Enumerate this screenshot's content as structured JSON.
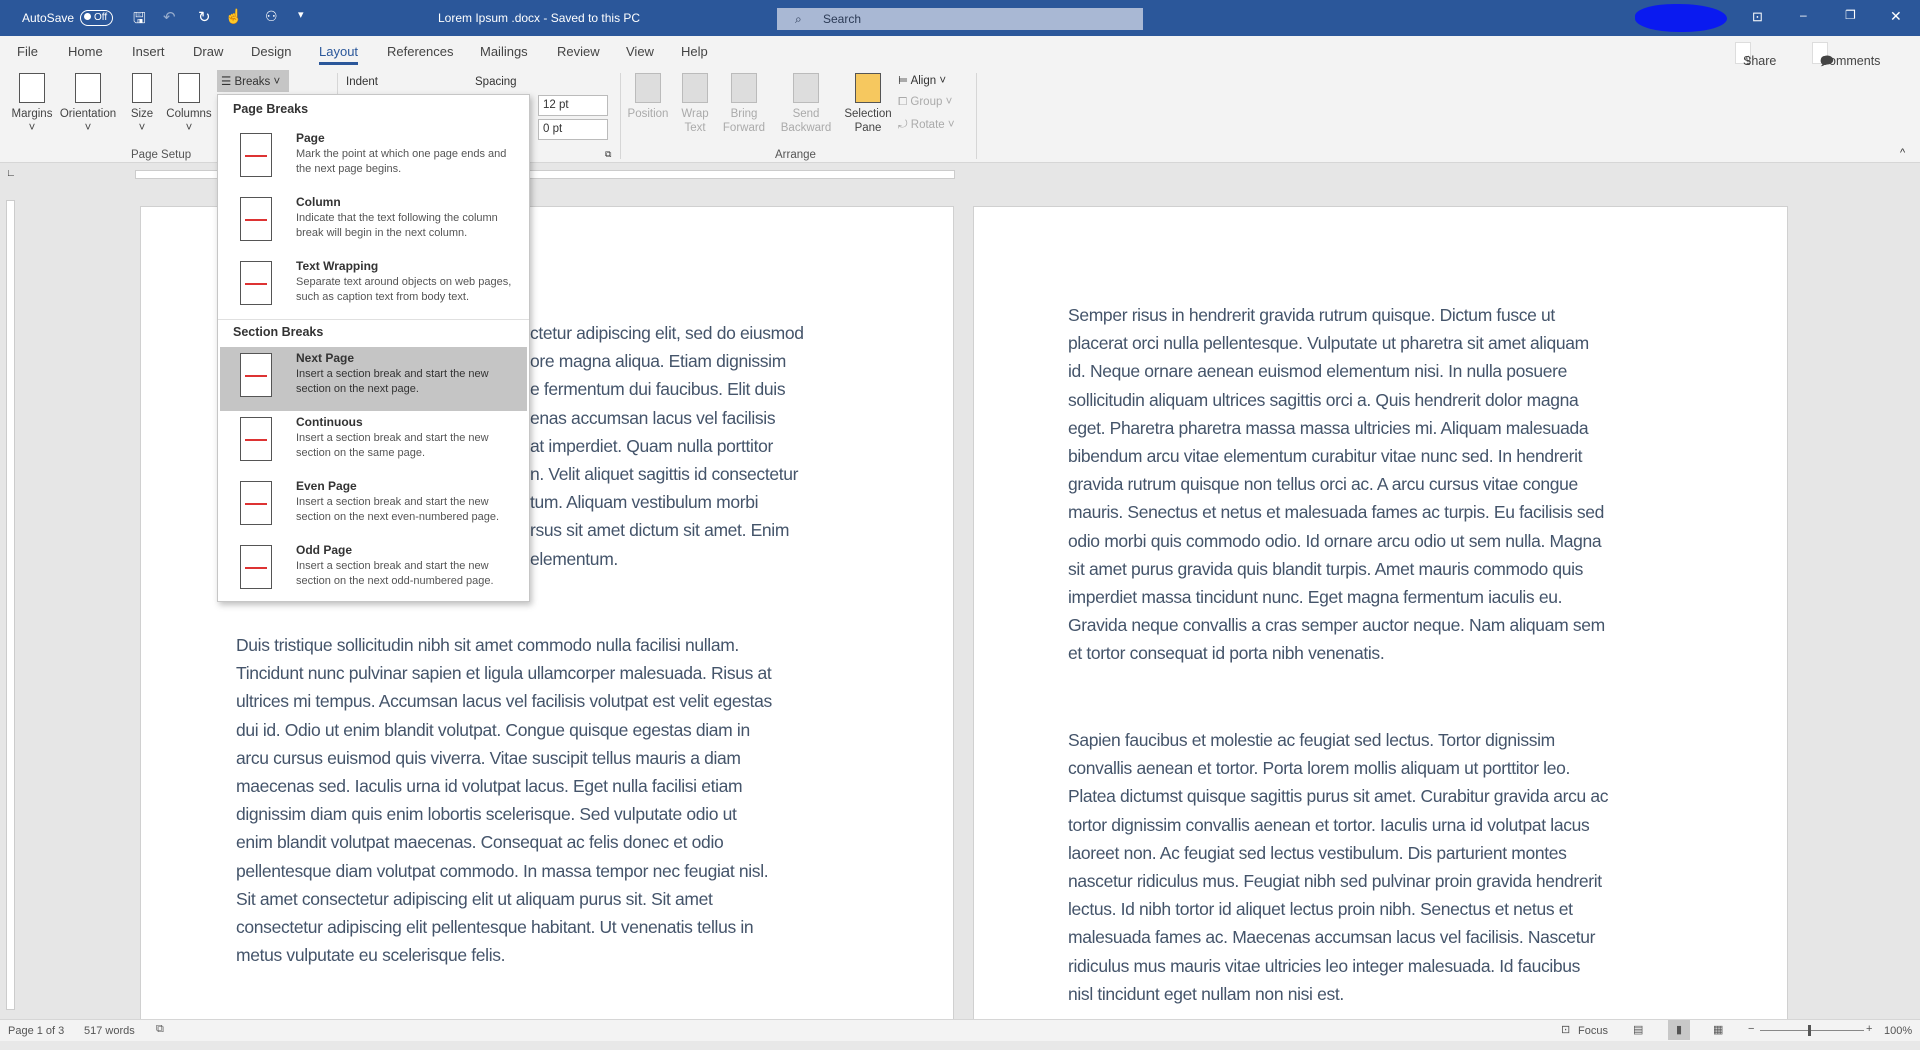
{
  "titlebar": {
    "autosave_label": "AutoSave",
    "autosave_state": "Off",
    "doc_title": "Lorem Ipsum .docx  -  Saved to this PC",
    "search_placeholder": "Search",
    "brand_color": "#2b579a"
  },
  "tabs": [
    "File",
    "Home",
    "Insert",
    "Draw",
    "Design",
    "Layout",
    "References",
    "Mailings",
    "Review",
    "View",
    "Help"
  ],
  "active_tab": "Layout",
  "share_label": "Share",
  "comments_label": "Comments",
  "ribbon": {
    "page_setup": {
      "items": [
        "Margins",
        "Orientation",
        "Size",
        "Columns"
      ],
      "breaks": "Breaks",
      "group": "Page Setup"
    },
    "paragraph": {
      "indent": "Indent",
      "spacing": "Spacing",
      "spacing_before": "12 pt",
      "spacing_after": "0 pt"
    },
    "arrange": {
      "items": [
        "Position",
        "Wrap Text",
        "Bring Forward",
        "Send Backward",
        "Selection Pane"
      ],
      "align": "Align",
      "group_btn": "Group",
      "rotate": "Rotate",
      "group": "Arrange"
    }
  },
  "breaks_menu": {
    "page_breaks_header": "Page Breaks",
    "section_breaks_header": "Section Breaks",
    "page_items": [
      {
        "title": "Page",
        "desc": "Mark the point at which one page ends and the next page begins."
      },
      {
        "title": "Column",
        "desc": "Indicate that the text following the column break will begin in the next column."
      },
      {
        "title": "Text Wrapping",
        "desc": "Separate text around objects on web pages, such as caption text from body text."
      }
    ],
    "section_items": [
      {
        "title": "Next Page",
        "desc": "Insert a section break and start the new section on the next page."
      },
      {
        "title": "Continuous",
        "desc": "Insert a section break and start the new section on the same page."
      },
      {
        "title": "Even Page",
        "desc": "Insert a section break and start the new section on the next even-numbered page."
      },
      {
        "title": "Odd Page",
        "desc": "Insert a section break and start the new section on the next odd-numbered page."
      }
    ],
    "highlighted": "Next Page"
  },
  "page1": {
    "para1_visible_fragments": [
      "ctetur adipiscing elit, sed do eiusmod",
      "ore magna aliqua. Etiam dignissim",
      "e fermentum dui faucibus. Elit duis",
      "enas accumsan lacus vel facilisis",
      "at imperdiet. Quam nulla porttitor",
      "n. Velit aliquet sagittis id consectetur",
      "tum. Aliquam vestibulum morbi",
      "rsus sit amet dictum sit amet. Enim",
      "elementum."
    ],
    "para2": [
      "Duis tristique sollicitudin nibh sit amet commodo nulla facilisi nullam.",
      "Tincidunt nunc pulvinar sapien et ligula ullamcorper malesuada. Risus at",
      "ultrices mi tempus. Accumsan lacus vel facilisis volutpat est velit egestas",
      "dui id. Odio ut enim blandit volutpat. Congue quisque egestas diam in",
      "arcu cursus euismod quis viverra. Vitae suscipit tellus mauris a diam",
      "maecenas sed. Iaculis urna id volutpat lacus. Eget nulla facilisi etiam",
      "dignissim diam quis enim lobortis scelerisque. Sed vulputate odio ut",
      "enim blandit volutpat maecenas. Consequat ac felis donec et odio",
      "pellentesque diam volutpat commodo. In massa tempor nec feugiat nisl.",
      "Sit amet consectetur adipiscing elit ut aliquam purus sit. Sit amet",
      "consectetur adipiscing elit pellentesque habitant. Ut venenatis tellus in",
      "metus vulputate eu scelerisque felis."
    ]
  },
  "page2": {
    "para1": [
      "Semper risus in hendrerit gravida rutrum quisque. Dictum fusce ut",
      "placerat orci nulla pellentesque. Vulputate ut pharetra sit amet aliquam",
      "id. Neque ornare aenean euismod elementum nisi. In nulla posuere",
      "sollicitudin aliquam ultrices sagittis orci a. Quis hendrerit dolor magna",
      "eget. Pharetra pharetra massa massa ultricies mi. Aliquam malesuada",
      "bibendum arcu vitae elementum curabitur vitae nunc sed. In hendrerit",
      "gravida rutrum quisque non tellus orci ac. A arcu cursus vitae congue",
      "mauris. Senectus et netus et malesuada fames ac turpis. Eu facilisis sed",
      "odio morbi quis commodo odio. Id ornare arcu odio ut sem nulla. Magna",
      "sit amet purus gravida quis blandit turpis. Amet mauris commodo quis",
      "imperdiet massa tincidunt nunc. Eget magna fermentum iaculis eu.",
      "Gravida neque convallis a cras semper auctor neque. Nam aliquam sem",
      "et tortor consequat id porta nibh venenatis."
    ],
    "para2": [
      "Sapien faucibus et molestie ac feugiat sed lectus. Tortor dignissim",
      "convallis aenean et tortor. Porta lorem mollis aliquam ut porttitor leo.",
      "Platea dictumst quisque sagittis purus sit amet. Curabitur gravida arcu ac",
      "tortor dignissim convallis aenean et tortor. Iaculis urna id volutpat lacus",
      "laoreet non. Ac feugiat sed lectus vestibulum. Dis parturient montes",
      "nascetur ridiculus mus. Feugiat nibh sed pulvinar proin gravida hendrerit",
      "lectus. Id nibh tortor id aliquet lectus proin nibh. Senectus et netus et",
      "malesuada fames ac. Maecenas accumsan lacus vel facilisis. Nascetur",
      "ridiculus mus mauris vitae ultricies leo integer malesuada. Id faucibus",
      "nisl tincidunt eget nullam non nisi est."
    ]
  },
  "status": {
    "page": "Page 1 of 3",
    "words": "517 words",
    "focus": "Focus",
    "zoom": "100%",
    "zoom_percent": 100
  }
}
